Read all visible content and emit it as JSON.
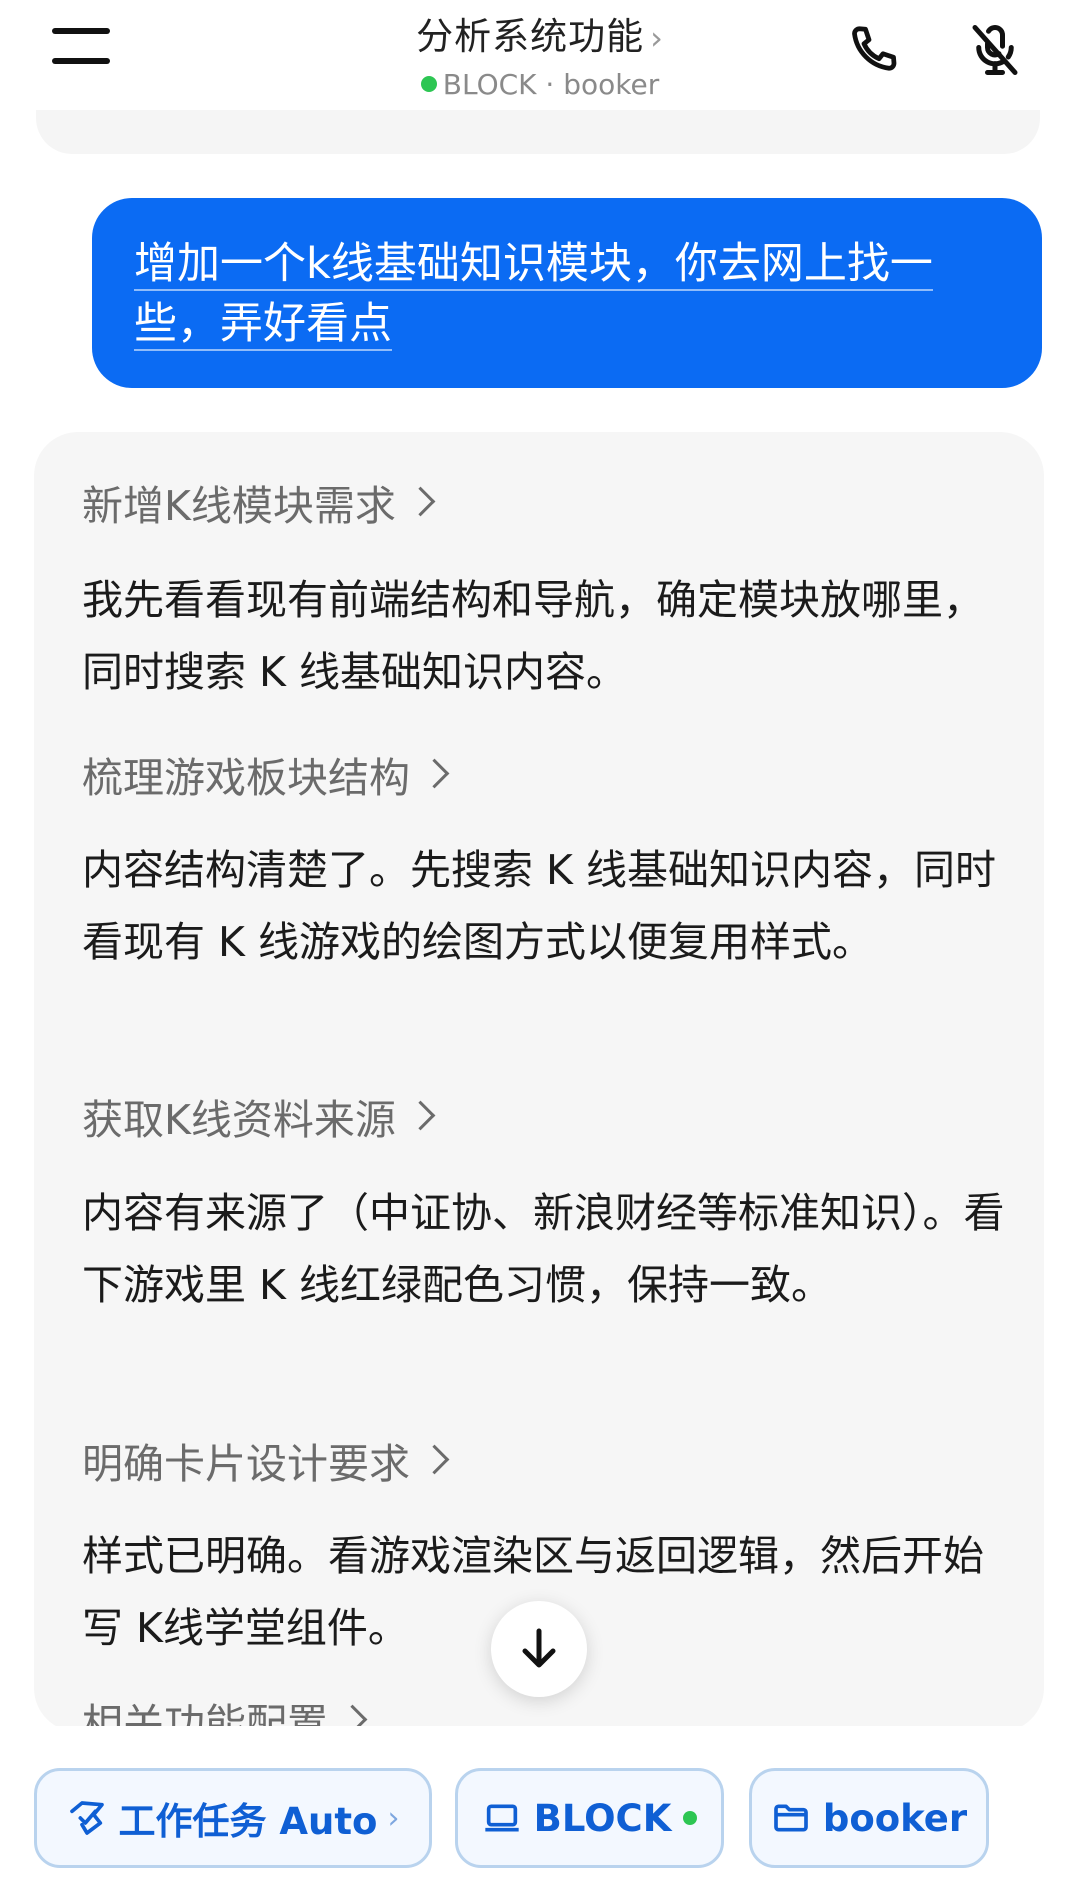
{
  "header": {
    "title": "分析系统功能",
    "title_chevron": "›",
    "status_color": "#2dc653",
    "subtitle": "BLOCK · booker",
    "icons": [
      "menu-icon",
      "phone-icon",
      "mute-microphone-icon"
    ]
  },
  "user_message": {
    "text": "增加一个k线基础知识模块，你去网上找一些，弄好看点",
    "bubble_color": "#0b6bf3"
  },
  "assistant": {
    "steps": [
      {
        "title": "新增K线模块需求",
        "body": "我先看看现有前端结构和导航，确定模块放哪里，同时搜索 K 线基础知识内容。"
      },
      {
        "title": "梳理游戏板块结构",
        "body": "内容结构清楚了。先搜索 K 线基础知识内容，同时看现有 K 线游戏的绘图方式以便复用样式。"
      },
      {
        "title": "获取K线资料来源",
        "body": "内容有来源了（中证协、新浪财经等标准知识）。看下游戏里 K 线红绿配色习惯，保持一致。"
      },
      {
        "title": "明确卡片设计要求",
        "body": "样式已明确。看游戏渲染区与返回逻辑，然后开始写 K线学堂组件。"
      },
      {
        "title": "相关功能配置",
        "body": ""
      }
    ]
  },
  "scroll_button": {
    "icon": "arrow-down-icon"
  },
  "bottom_bar": {
    "task_chip": {
      "icon": "task-icon",
      "label": "工作任务 Auto",
      "chevron": "›"
    },
    "block_chip": {
      "icon": "laptop-icon",
      "label": "BLOCK",
      "status_color": "#2dc653"
    },
    "booker_chip": {
      "icon": "folder-icon",
      "label": "booker"
    },
    "accent_color": "#0f5fd4"
  }
}
